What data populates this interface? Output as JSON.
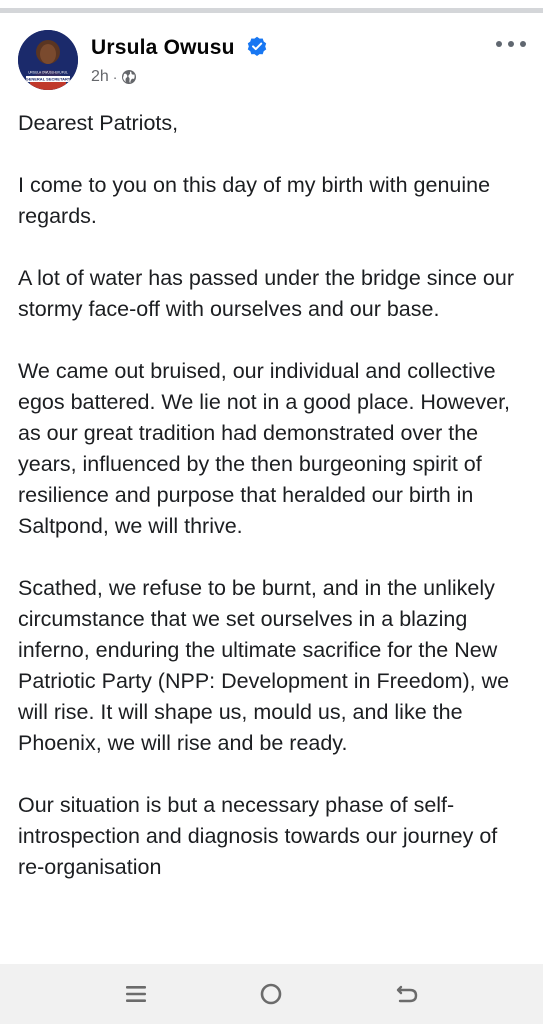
{
  "post": {
    "author": "Ursula Owusu",
    "time": "2h",
    "audience_icon": "globe-icon",
    "verified_icon": "verified-badge-icon",
    "avatar_caption_line1": "URSULA OWUSU-EKUFUL",
    "avatar_caption_line2": "GENERAL SECRETARY",
    "paragraphs": [
      "Dearest Patriots,",
      "I come to you on this day of my birth with genuine regards.",
      "A lot of water has passed under the bridge since our stormy face-off with ourselves and our base.",
      "We came out bruised, our individual and collective egos battered. We lie not in a good place. However, as our great tradition had demonstrated over the years, influenced by the then burgeoning spirit of resilience and purpose that heralded our birth in Saltpond, we will thrive.",
      "Scathed, we refuse to be burnt, and in the unlikely circumstance that we set ourselves in a blazing inferno,  enduring the ultimate sacrifice for the New Patriotic Party (NPP: Development in Freedom), we will rise. It will shape us, mould us, and like the Phoenix, we will rise and be ready.",
      "Our situation is but a necessary phase of self-introspection and diagnosis towards our journey of re-organisation"
    ]
  },
  "colors": {
    "verified_blue": "#1877f2",
    "meta_gray": "#65676b",
    "avatar_bg": "#1b2a6b",
    "nav_bg": "#f1f1f1"
  },
  "navigation": {
    "buttons": [
      "recent-apps-icon",
      "home-icon",
      "back-icon"
    ]
  }
}
